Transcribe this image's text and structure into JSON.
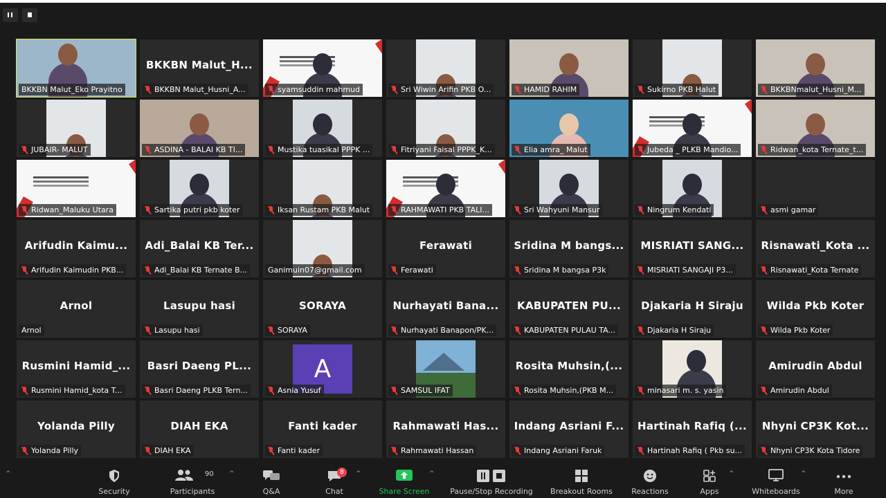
{
  "window": {
    "pause_icon": "pause-icon",
    "stop_icon": "stop-icon"
  },
  "tiles": [
    {
      "label": "BKKBN Malut_Eko Prayitno",
      "big": "",
      "mic": false,
      "kind": "cam-outdoor",
      "active": true
    },
    {
      "label": "BKKBN Malut_Husni_A...",
      "big": "BKKBN  Malut_H...",
      "mic": true,
      "kind": "none"
    },
    {
      "label": "syamsuddin mahmud",
      "big": "",
      "mic": true,
      "kind": "slide-person"
    },
    {
      "label": "Sri Wiwin Arifin PKB O...",
      "big": "",
      "mic": true,
      "kind": "cam-room"
    },
    {
      "label": "HAMID RAHIM",
      "big": "",
      "mic": true,
      "kind": "cam-man"
    },
    {
      "label": "Sukirno PKB Halut",
      "big": "",
      "mic": true,
      "kind": "cam-room"
    },
    {
      "label": "BKKBNmalut_Husni_M...",
      "big": "",
      "mic": true,
      "kind": "cam-man"
    },
    {
      "label": "JUBAIR- MALUT",
      "big": "",
      "mic": true,
      "kind": "cam-room"
    },
    {
      "label": "ASDINA - BALAI KB TI...",
      "big": "",
      "mic": true,
      "kind": "cam-group"
    },
    {
      "label": "Mustika tuasikal PPPK ...",
      "big": "",
      "mic": true,
      "kind": "cam-hijab"
    },
    {
      "label": "Fitriyani Faisal PPPK_K...",
      "big": "",
      "mic": true,
      "kind": "cam-room"
    },
    {
      "label": "Elia amra_ Malut",
      "big": "",
      "mic": true,
      "kind": "cam-woman"
    },
    {
      "label": "Jubeda _ PLKB Mandio...",
      "big": "",
      "mic": true,
      "kind": "slide-person"
    },
    {
      "label": "Ridwan_kota Ternate_t...",
      "big": "",
      "mic": true,
      "kind": "cam-man"
    },
    {
      "label": "Ridwan_Maluku Utara",
      "big": "",
      "mic": true,
      "kind": "slide"
    },
    {
      "label": "Sartika putri pkb koter",
      "big": "",
      "mic": true,
      "kind": "cam-hijab"
    },
    {
      "label": "Iksan Rustam PKB Malut",
      "big": "",
      "mic": true,
      "kind": "cam-room"
    },
    {
      "label": "RAHMAWATI PKB TALI...",
      "big": "",
      "mic": true,
      "kind": "slide-person"
    },
    {
      "label": "Sri Wahyuni Mansur",
      "big": "",
      "mic": true,
      "kind": "cam-hijab"
    },
    {
      "label": "Ningrum Kendati",
      "big": "",
      "mic": true,
      "kind": "cam-hijab"
    },
    {
      "label": "asmi gamar",
      "big": "",
      "mic": true,
      "kind": "none"
    },
    {
      "label": "Arifudin Kaimudin PKB...",
      "big": "Arifudin  Kaimu...",
      "mic": true,
      "kind": "none"
    },
    {
      "label": "Adi_Balai KB Ternate B...",
      "big": "Adi_Balai KB Ter...",
      "mic": true,
      "kind": "none"
    },
    {
      "label": "Ganimuin07@gmail.com",
      "big": "",
      "mic": false,
      "kind": "cam-room"
    },
    {
      "label": "Ferawati",
      "big": "Ferawati",
      "mic": true,
      "kind": "none"
    },
    {
      "label": "Sridina M bangsa P3k",
      "big": "Sridina M bangs...",
      "mic": true,
      "kind": "none"
    },
    {
      "label": "MISRIATI SANGAJI P3...",
      "big": "MISRIATI  SANG...",
      "mic": true,
      "kind": "none"
    },
    {
      "label": "Risnawati_Kota Ternate",
      "big": "Risnawati_Kota ...",
      "mic": true,
      "kind": "none"
    },
    {
      "label": "Arnol",
      "big": "Arnol",
      "mic": false,
      "kind": "none"
    },
    {
      "label": "Lasupu hasi",
      "big": "Lasupu hasi",
      "mic": true,
      "kind": "none"
    },
    {
      "label": "SORAYA",
      "big": "SORAYA",
      "mic": true,
      "kind": "none"
    },
    {
      "label": "Nurhayati Banapon/PK...",
      "big": "Nurhayati  Bana...",
      "mic": true,
      "kind": "none"
    },
    {
      "label": "KABUPATEN PULAU TA...",
      "big": "KABUPATEN  PU...",
      "mic": true,
      "kind": "none"
    },
    {
      "label": "Djakaria H Siraju",
      "big": "Djakaria H Siraju",
      "mic": true,
      "kind": "none"
    },
    {
      "label": "Wilda Pkb Koter",
      "big": "Wilda Pkb Koter",
      "mic": true,
      "kind": "none"
    },
    {
      "label": "Rusmini Hamid_kota T...",
      "big": "Rusmini  Hamid_...",
      "mic": true,
      "kind": "none"
    },
    {
      "label": "Basri Daeng PLKB Tern...",
      "big": "Basri Daeng PL...",
      "mic": true,
      "kind": "none"
    },
    {
      "label": "Asnia Yusuf",
      "big": "",
      "mic": true,
      "kind": "avatar",
      "avatar_letter": "A"
    },
    {
      "label": "SAMSUL IFAT",
      "big": "",
      "mic": true,
      "kind": "landscape"
    },
    {
      "label": "Rosita Muhsin,(PKB M...",
      "big": "Rosita  Muhsin,(...",
      "mic": true,
      "kind": "none"
    },
    {
      "label": "minasari m. s. yasin",
      "big": "",
      "mic": true,
      "kind": "cam-standing"
    },
    {
      "label": "Amirudin Abdul",
      "big": "Amirudin Abdul",
      "mic": true,
      "kind": "none"
    },
    {
      "label": "Yolanda Pilly",
      "big": "Yolanda Pilly",
      "mic": true,
      "kind": "none"
    },
    {
      "label": "DIAH EKA",
      "big": "DIAH EKA",
      "mic": true,
      "kind": "none"
    },
    {
      "label": "Fanti kader",
      "big": "Fanti kader",
      "mic": true,
      "kind": "none"
    },
    {
      "label": "Rahmawati Hassan",
      "big": "Rahmawati  Has...",
      "mic": true,
      "kind": "none"
    },
    {
      "label": "Indang Asriani Faruk",
      "big": "Indang Asriani F...",
      "mic": true,
      "kind": "none"
    },
    {
      "label": "Hartinah Rafiq ( Pkb su...",
      "big": "Hartinah Rafiq (...",
      "mic": true,
      "kind": "none"
    },
    {
      "label": "Nhyni CP3K Kota Tidore",
      "big": "Nhyni CP3K Kot...",
      "mic": true,
      "kind": "none"
    }
  ],
  "toolbar": {
    "security": "Security",
    "participants": "Participants",
    "participants_count": "90",
    "qa": "Q&A",
    "chat": "Chat",
    "chat_badge": "8",
    "share": "Share Screen",
    "recording": "Pause/Stop Recording",
    "breakout": "Breakout Rooms",
    "reactions": "Reactions",
    "apps": "Apps",
    "whiteboards": "Whiteboards",
    "more": "More"
  },
  "colors": {
    "accent_green": "#25c55a",
    "active_border": "#d9e85b",
    "muted_red": "#e63a3a",
    "avatar_purple": "#5b3fb5"
  }
}
